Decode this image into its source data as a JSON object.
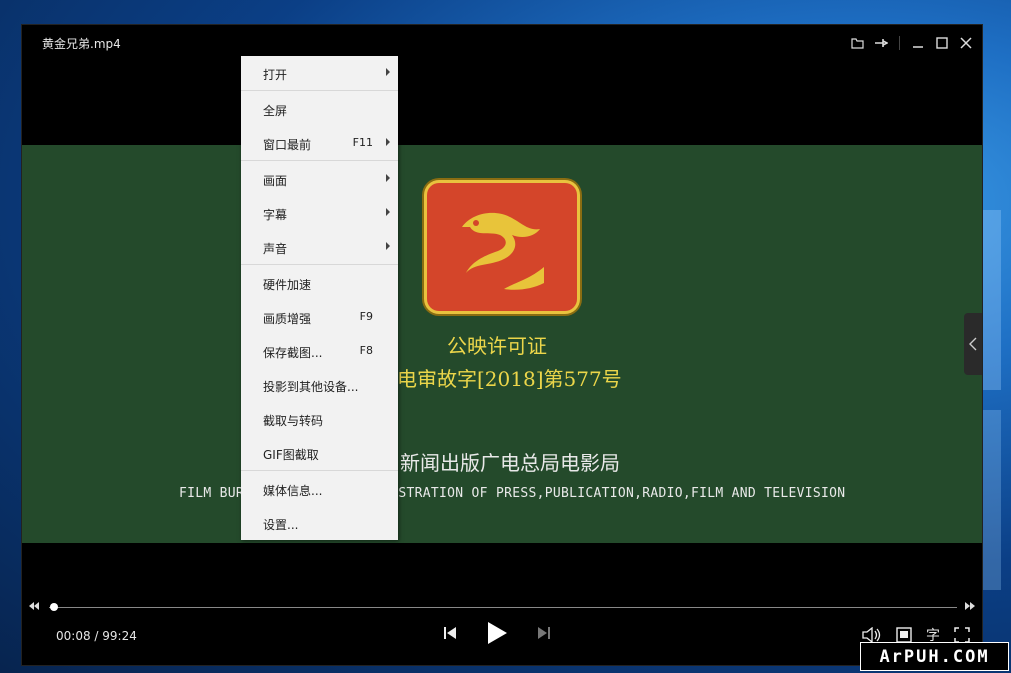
{
  "window": {
    "title": "黄金兄弟.mp4"
  },
  "video": {
    "permit_title": "公映许可证",
    "permit_number": "电审故字[2018]第577号",
    "bureau_cn": "新闻出版广电总局电影局",
    "bureau_en": "FILM BUREAU OF STATE ADMINISTRATION OF PRESS,PUBLICATION,RADIO,FILM AND TELEVISION",
    "bg_color": "#244a2b",
    "text_color": "#ecd64a"
  },
  "context_menu": {
    "open": "打开",
    "fullscreen": "全屏",
    "always_on_top": "窗口最前",
    "always_on_top_key": "F11",
    "picture": "画面",
    "subtitles": "字幕",
    "audio": "声音",
    "hw_accel": "硬件加速",
    "enhance": "画质增强",
    "enhance_key": "F9",
    "save_screenshot": "保存截图...",
    "save_screenshot_key": "F8",
    "cast": "投影到其他设备...",
    "clip_convert": "截取与转码",
    "gif_capture": "GIF图截取",
    "media_info": "媒体信息...",
    "settings": "设置..."
  },
  "controls": {
    "time": "00:08 / 99:24",
    "progress": 0.005,
    "subtitle_char": "字"
  },
  "watermark": {
    "text": "ArPUH.COM"
  }
}
